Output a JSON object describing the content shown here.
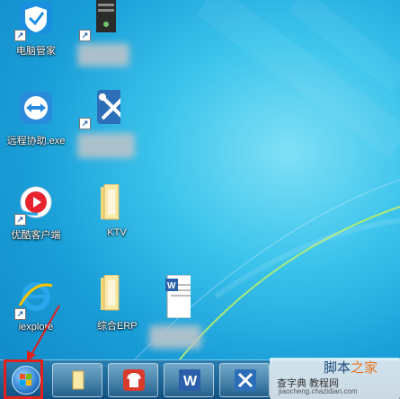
{
  "desktop_icons": [
    {
      "id": "tencent-manager",
      "label": "电脑管家"
    },
    {
      "id": "remote-assist",
      "label": "远程协助.exe"
    },
    {
      "id": "youku-client",
      "label": "优酷客户端"
    },
    {
      "id": "ie",
      "label": "iexplore"
    },
    {
      "id": "ktv-folder",
      "label": "KTV"
    },
    {
      "id": "erp-folder",
      "label": "综合ERP"
    }
  ],
  "watermark": {
    "main_prefix": "脚本",
    "main_highlight": "之家",
    "sub": "查字典 教程网",
    "url": "jiaocheng.chazidian.com"
  },
  "colors": {
    "highlight_box": "#e3201b",
    "desktop_bg": "#1a9fd8"
  }
}
